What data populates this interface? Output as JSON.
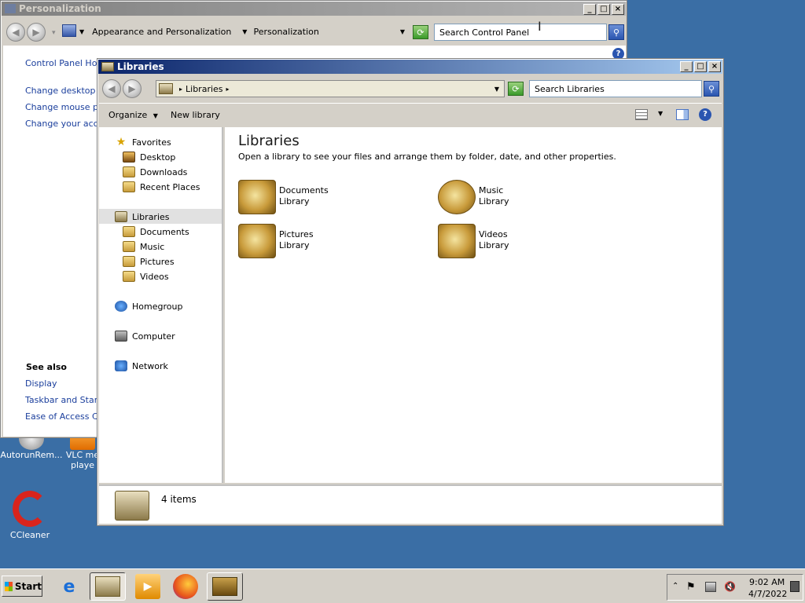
{
  "personalization": {
    "title": "Personalization",
    "breadcrumb": [
      "Appearance and Personalization",
      "Personalization"
    ],
    "search_placeholder": "Search Control Panel",
    "left_links": [
      "Control Panel Home",
      "Change desktop ico",
      "Change mouse poin",
      "Change your accou"
    ],
    "see_also_label": "See also",
    "see_also_links": [
      "Display",
      "Taskbar and Start M",
      "Ease of Access Cer"
    ]
  },
  "libraries": {
    "title": "Libraries",
    "address": "Libraries",
    "search_placeholder": "Search Libraries",
    "toolbar": {
      "organize": "Organize",
      "new_library": "New library"
    },
    "nav": {
      "favorites_header": "Favorites",
      "favorites": [
        "Desktop",
        "Downloads",
        "Recent Places"
      ],
      "libraries_header": "Libraries",
      "libraries": [
        "Documents",
        "Music",
        "Pictures",
        "Videos"
      ],
      "homegroup": "Homegroup",
      "computer": "Computer",
      "network": "Network"
    },
    "heading": "Libraries",
    "description": "Open a library to see your files and arrange them by folder, date, and other properties.",
    "items": [
      {
        "name": "Documents",
        "sub": "Library"
      },
      {
        "name": "Music",
        "sub": "Library"
      },
      {
        "name": "Pictures",
        "sub": "Library"
      },
      {
        "name": "Videos",
        "sub": "Library"
      }
    ],
    "status": "4 items"
  },
  "desktop": {
    "icons": [
      "AutorunRem...",
      "VLC me playe",
      "CCleaner"
    ]
  },
  "taskbar": {
    "start": "Start",
    "time": "9:02 AM",
    "date": "4/7/2022"
  }
}
